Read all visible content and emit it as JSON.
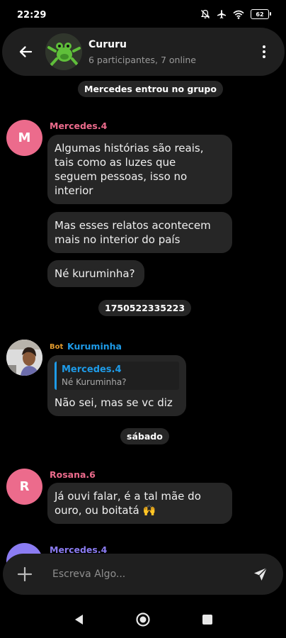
{
  "status_bar": {
    "time": "22:29",
    "battery": "62"
  },
  "header": {
    "title": "Cururu",
    "subtitle": "6 participantes, 7 online"
  },
  "system_message": "Mercedes entrou no grupo",
  "messages": [
    {
      "sender": "Mercedes.4",
      "avatar_letter": "M",
      "color": "#ec6b8c",
      "bubbles": [
        [
          "Algumas histórias são reais,",
          "tais como as luzes que",
          "seguem pessoas, isso no",
          "interior"
        ],
        [
          "Mas esses relatos acontecem",
          "mais no interior do país"
        ],
        [
          "Né kuruminha?"
        ]
      ]
    },
    {
      "sender": "Kuruminha",
      "tag": "Bot",
      "tag_color": "#e39b2d",
      "color": "#1e9be8",
      "quote": {
        "name": "Mercedes.4",
        "text": "Né Kuruminha?"
      },
      "text": "Não sei, mas se vc diz"
    },
    {
      "sender": "Rosana.6",
      "avatar_letter": "R",
      "color": "#ec6b8c",
      "bubbles": [
        [
          "Já ouvi falar, é a tal mãe do",
          "ouro, ou boitatá 🙌"
        ]
      ]
    },
    {
      "sender": "Mercedes.4",
      "color": "#8b7cf2"
    }
  ],
  "timestamp_chip": "1750522335223",
  "date_chip": "sábado",
  "composer": {
    "placeholder": "Escreva Algo..."
  },
  "icons": [
    "arrow-left-icon",
    "more-vert-icon",
    "plus-icon",
    "send-icon",
    "nav-back-icon",
    "nav-home-icon",
    "nav-recents-icon",
    "mute-bell-icon",
    "airplane-icon",
    "wifi-icon",
    "battery-icon"
  ]
}
